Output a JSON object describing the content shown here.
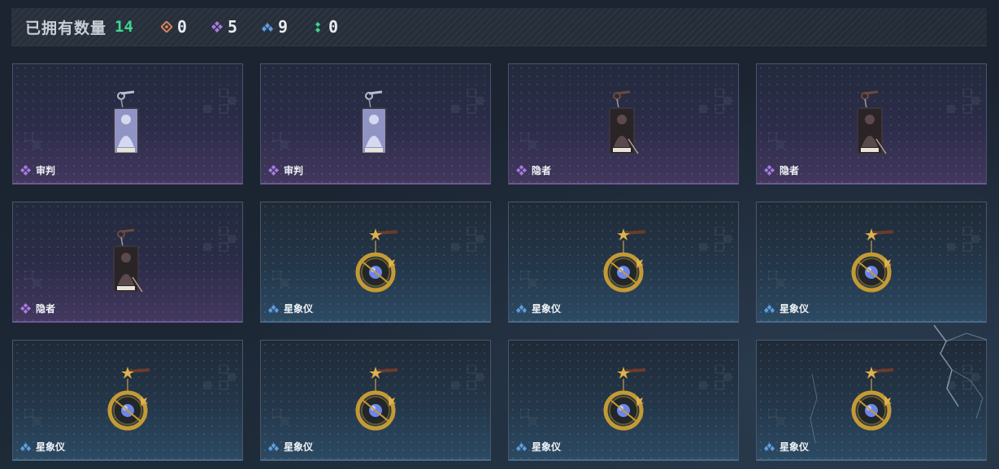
{
  "header": {
    "owned_label": "已拥有数量",
    "owned_count": "14",
    "stats": [
      {
        "icon": "orange-rarity-icon",
        "color": "#d9835a",
        "value": "0"
      },
      {
        "icon": "purple-rarity-icon",
        "color": "#a77be0",
        "value": "5"
      },
      {
        "icon": "blue-rarity-icon",
        "color": "#5c9fe0",
        "value": "9"
      },
      {
        "icon": "green-rarity-icon",
        "color": "#3ed68f",
        "value": "0"
      }
    ]
  },
  "items": [
    {
      "name": "审判",
      "rarity": "purple",
      "icon": "judgement-tarot-charm-icon"
    },
    {
      "name": "审判",
      "rarity": "purple",
      "icon": "judgement-tarot-charm-icon"
    },
    {
      "name": "隐者",
      "rarity": "purple",
      "icon": "hermit-tarot-charm-icon"
    },
    {
      "name": "隐者",
      "rarity": "purple",
      "icon": "hermit-tarot-charm-icon"
    },
    {
      "name": "隐者",
      "rarity": "purple",
      "icon": "hermit-tarot-charm-icon"
    },
    {
      "name": "星象仪",
      "rarity": "blue",
      "icon": "astrolabe-charm-icon"
    },
    {
      "name": "星象仪",
      "rarity": "blue",
      "icon": "astrolabe-charm-icon"
    },
    {
      "name": "星象仪",
      "rarity": "blue",
      "icon": "astrolabe-charm-icon"
    },
    {
      "name": "星象仪",
      "rarity": "blue",
      "icon": "astrolabe-charm-icon"
    },
    {
      "name": "星象仪",
      "rarity": "blue",
      "icon": "astrolabe-charm-icon"
    },
    {
      "name": "星象仪",
      "rarity": "blue",
      "icon": "astrolabe-charm-icon"
    },
    {
      "name": "星象仪",
      "rarity": "blue",
      "icon": "astrolabe-charm-icon"
    }
  ]
}
